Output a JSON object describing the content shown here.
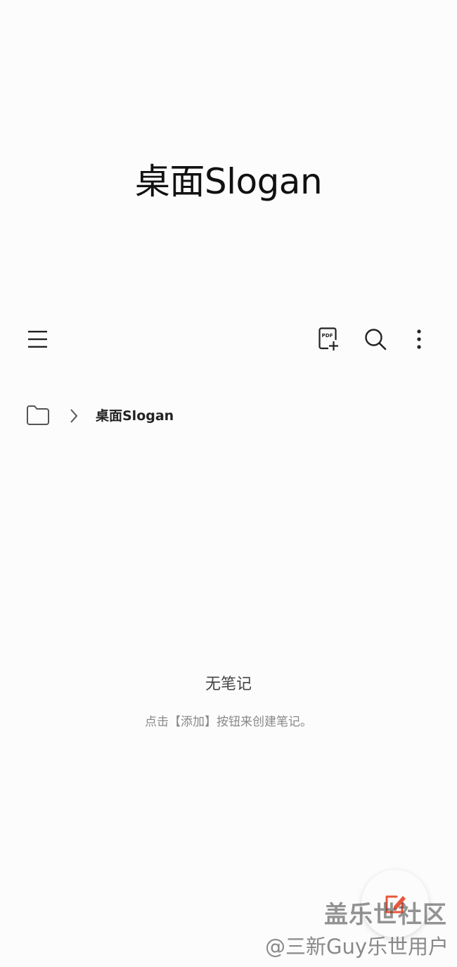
{
  "folder": {
    "title": "桌面Slogan"
  },
  "toolbar": {
    "menu_icon": "menu-icon",
    "pdf_icon": "pdf-add-icon",
    "search_icon": "search-icon",
    "more_icon": "more-vertical-icon"
  },
  "breadcrumb": {
    "folder_icon": "folder-icon",
    "chevron_icon": "chevron-right-icon",
    "current": "桌面Slogan"
  },
  "empty_state": {
    "title": "无笔记",
    "description": "点击【添加】按钮来创建笔记。"
  },
  "fab": {
    "icon": "new-note-icon"
  },
  "watermark": {
    "line1": "盖乐世社区",
    "line2": "@三新Guy乐世用户"
  },
  "colors": {
    "background": "#fcfcfc",
    "accent": "#e8573a"
  }
}
